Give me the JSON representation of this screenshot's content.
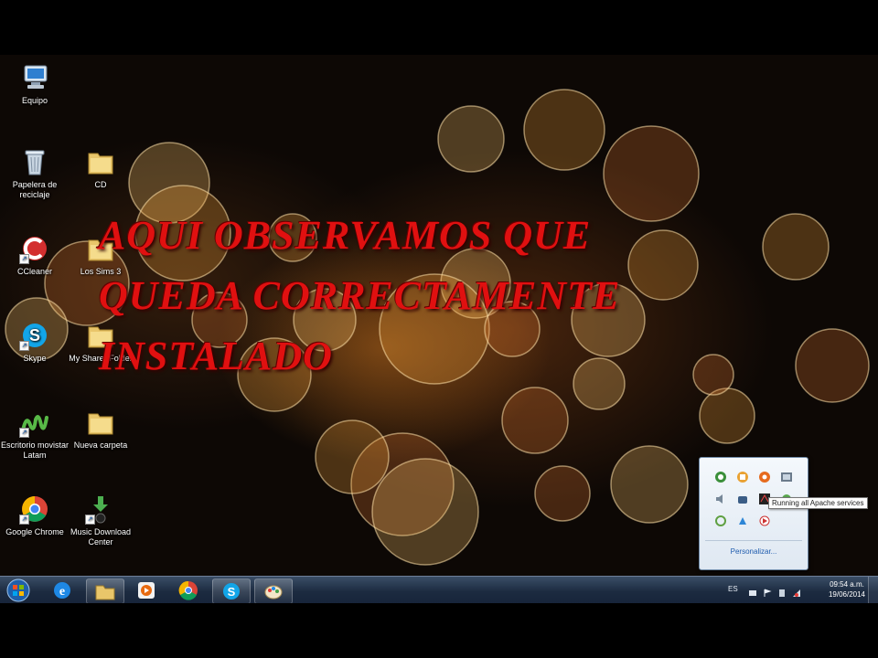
{
  "desktop": {
    "icons": [
      {
        "label": "Equipo",
        "icon": "computer-icon"
      },
      {
        "label": "Papelera de reciclaje",
        "icon": "recycle-bin-icon"
      },
      {
        "label": "CD",
        "icon": "folder-icon"
      },
      {
        "label": "CCleaner",
        "icon": "ccleaner-icon"
      },
      {
        "label": "Los Sims 3",
        "icon": "folder-icon"
      },
      {
        "label": "Skype",
        "icon": "skype-icon"
      },
      {
        "label": "My Sharer Folder",
        "icon": "folder-icon"
      },
      {
        "label": "Escritorio movistar Latam",
        "icon": "movistar-icon"
      },
      {
        "label": "Nueva carpeta",
        "icon": "folder-icon"
      },
      {
        "label": "Google Chrome",
        "icon": "chrome-icon"
      },
      {
        "label": "Music Download Center",
        "icon": "download-icon"
      }
    ]
  },
  "overlay": {
    "lines": [
      "AQUI OBSERVAMOS QUE",
      "QUEDA CORRECTAMENTE",
      "INSTALADO"
    ],
    "color": "#e01010"
  },
  "taskbar": {
    "pinned": [
      "internet-explorer-icon",
      "windows-explorer-icon",
      "media-player-icon",
      "chrome-icon",
      "skype-icon",
      "paint-icon"
    ],
    "language": "ES",
    "time": "09:54 a.m.",
    "date": "19/06/2014"
  },
  "tray_popup": {
    "customize_label": "Personalizar...",
    "tooltip": "Running all Apache services",
    "icons": [
      "xampp-icon",
      "network-icon",
      "update-icon",
      "display-icon",
      "audio-icon",
      "flash-icon",
      "apache-icon",
      "usb-icon",
      "cloud-icon",
      "ccleaner-tray-icon",
      "media-tray-icon"
    ]
  }
}
